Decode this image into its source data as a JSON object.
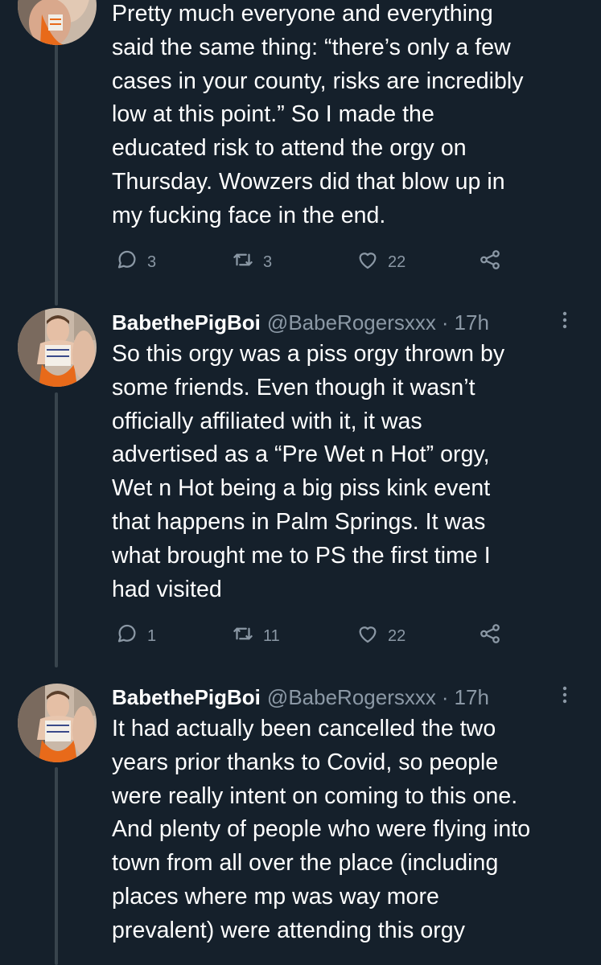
{
  "thread": [
    {
      "show_header": false,
      "text_lines": [
        "Pretty much everyone and everything",
        "said the same thing: “there’s only a few",
        "cases in your county, risks are incredibly",
        "low at this point.” So I made the",
        "educated risk to attend the orgy on",
        "Thursday. Wowzers did that blow up in",
        "my fucking face in the end."
      ],
      "replies": "3",
      "retweets": "3",
      "likes": "22"
    },
    {
      "show_header": true,
      "display_name": "BabethePigBoi",
      "handle": "@BabeRogersxxx",
      "separator": "·",
      "time": "17h",
      "text_lines": [
        "So this orgy was a piss orgy thrown by",
        "some friends. Even though it wasn’t",
        "officially affiliated with it, it was",
        "advertised as a “Pre Wet n Hot” orgy,",
        "Wet n Hot being a big piss kink event",
        "that happens in Palm Springs. It was",
        "what brought me to PS the first time I",
        "had visited"
      ],
      "replies": "1",
      "retweets": "11",
      "likes": "22"
    },
    {
      "show_header": true,
      "display_name": "BabethePigBoi",
      "handle": "@BabeRogersxxx",
      "separator": "·",
      "time": "17h",
      "text_lines": [
        "It had actually been cancelled the two",
        "years prior thanks to Covid, so people",
        "were really intent on coming to this one.",
        "And plenty of people who were flying into",
        "town from all over the place (including",
        "places where mp was way more",
        "prevalent) were attending this orgy"
      ]
    }
  ],
  "icons": {
    "reply": "reply-icon",
    "retweet": "retweet-icon",
    "like": "heart-icon",
    "share": "share-icon",
    "more": "more-options-icon",
    "avatar": "avatar"
  },
  "colors": {
    "background": "#15202b",
    "text": "#ffffff",
    "secondary": "#8b98a5",
    "thread_line": "#38444d"
  }
}
